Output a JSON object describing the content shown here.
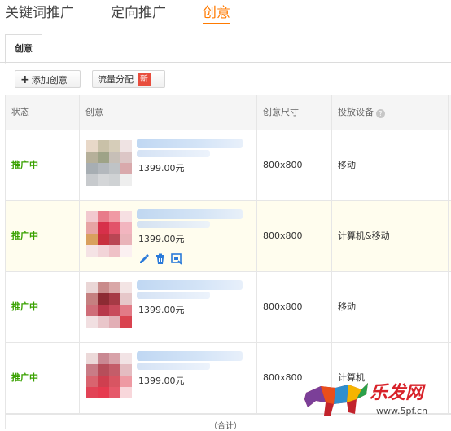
{
  "top_tabs": [
    {
      "label": "关键词推广"
    },
    {
      "label": "定向推广"
    },
    {
      "label": "创意"
    }
  ],
  "sub_tab": {
    "label": "创意"
  },
  "toolbar": {
    "add_label": "添加创意",
    "traffic_label": "流量分配",
    "new_badge": "新"
  },
  "table": {
    "headers": [
      "状态",
      "创意",
      "创意尺寸",
      "投放设备"
    ],
    "rows": [
      {
        "status": "推广中",
        "price": "1399.00元",
        "size": "800x800",
        "device": "移动"
      },
      {
        "status": "推广中",
        "price": "1399.00元",
        "size": "800x800",
        "device": "计算机&移动",
        "hover": true
      },
      {
        "status": "推广中",
        "price": "1399.00元",
        "size": "800x800",
        "device": "移动"
      },
      {
        "status": "推广中",
        "price": "1399.00元",
        "size": "800x800",
        "device": "计算机"
      }
    ],
    "footer": "（合计）"
  },
  "icons": {
    "help": "help-circle-icon",
    "edit": "pencil-icon",
    "delete": "trash-icon",
    "preview": "preview-icon",
    "add": "plus-icon"
  },
  "colors": {
    "accent": "#ff7a00",
    "status_green": "#39a100",
    "new_badge": "#e84d3d",
    "hover_row": "#fffdee",
    "action_blue": "#2a7ad9"
  },
  "watermark": {
    "brand": "乐发网",
    "url": "www.5pf.cn"
  }
}
